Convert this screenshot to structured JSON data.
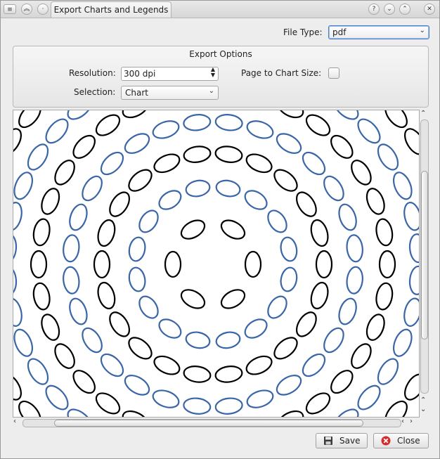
{
  "window": {
    "title": "Export Charts and Legends"
  },
  "file_type": {
    "label": "File Type:",
    "value": "pdf"
  },
  "export_options": {
    "title": "Export Options",
    "resolution_label": "Resolution:",
    "resolution_value": "300 dpi",
    "page_to_chart_label": "Page to Chart Size:",
    "page_to_chart_checked": false,
    "selection_label": "Selection:",
    "selection_value": "Chart"
  },
  "buttons": {
    "save": "Save",
    "close": "Close"
  },
  "colors": {
    "ring_black": "#000000",
    "ring_blue": "#3a66a8",
    "focus": "#4a7cc4",
    "close_red": "#d62b2b"
  },
  "preview": {
    "description_icons": [
      "ring-pattern"
    ]
  }
}
